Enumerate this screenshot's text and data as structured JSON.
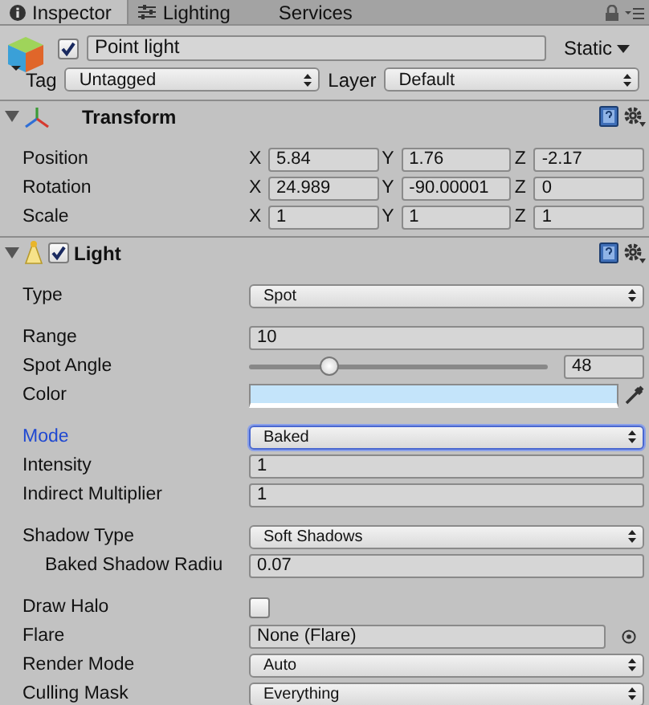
{
  "tabs": [
    {
      "label": "Inspector",
      "selected": true
    },
    {
      "label": "Lighting",
      "selected": false
    },
    {
      "label": "Services",
      "selected": false
    }
  ],
  "object": {
    "active": true,
    "name": "Point light",
    "static_label": "Static",
    "tag_label": "Tag",
    "tag": "Untagged",
    "layer_label": "Layer",
    "layer": "Default"
  },
  "components": [
    {
      "title": "Transform",
      "expanded": true,
      "groups": [
        {
          "rows": [
            {
              "label": "Position",
              "kind": "vector",
              "focused": false,
              "values": [
                {
                  "axis": "X",
                  "value": "5.84"
                },
                {
                  "axis": "Y",
                  "value": "1.76"
                },
                {
                  "axis": "Z",
                  "value": "-2.17"
                }
              ]
            },
            {
              "label": "Rotation",
              "kind": "vector",
              "focused": false,
              "values": [
                {
                  "axis": "X",
                  "value": "24.989"
                },
                {
                  "axis": "Y",
                  "value": "-90.00001"
                },
                {
                  "axis": "Z",
                  "value": "0"
                }
              ]
            },
            {
              "label": "Scale",
              "kind": "vector",
              "focused": false,
              "values": [
                {
                  "axis": "X",
                  "value": "1"
                },
                {
                  "axis": "Y",
                  "value": "1"
                },
                {
                  "axis": "Z",
                  "value": "1"
                }
              ]
            }
          ]
        }
      ]
    },
    {
      "title": "Light",
      "enabled": true,
      "expanded": true,
      "groups": [
        {
          "rows": [
            {
              "label": "Type",
              "kind": "dropdown",
              "focused": false,
              "value": "Spot"
            }
          ]
        },
        {
          "rows": [
            {
              "label": "Range",
              "kind": "field",
              "focused": false,
              "value": "10"
            },
            {
              "label": "Spot Angle",
              "kind": "slider",
              "focused": false,
              "level": 0.27,
              "value": "48"
            },
            {
              "label": "Color",
              "kind": "color",
              "focused": false,
              "color": "#c4e4fa"
            }
          ]
        },
        {
          "rows": [
            {
              "label": "Mode",
              "kind": "dropdown",
              "focused": true,
              "value": "Baked"
            },
            {
              "label": "Intensity",
              "kind": "field",
              "focused": false,
              "value": "1"
            },
            {
              "label": "Indirect Multiplier",
              "kind": "field",
              "focused": false,
              "value": "1"
            }
          ]
        },
        {
          "rows": [
            {
              "label": "Shadow Type",
              "kind": "dropdown",
              "focused": false,
              "value": "Soft Shadows",
              "children": [
                {
                  "label": "Baked Shadow Radiu",
                  "kind": "field",
                  "focused": false,
                  "value": "0.07"
                }
              ]
            }
          ]
        },
        {
          "rows": [
            {
              "label": "Draw Halo",
              "kind": "checkbox",
              "focused": false,
              "checked": false
            },
            {
              "label": "Flare",
              "kind": "object",
              "focused": false,
              "value": "None (Flare)"
            },
            {
              "label": "Render Mode",
              "kind": "dropdown",
              "focused": false,
              "value": "Auto"
            },
            {
              "label": "Culling Mask",
              "kind": "dropdown",
              "focused": false,
              "value": "Everything"
            }
          ]
        }
      ]
    }
  ]
}
